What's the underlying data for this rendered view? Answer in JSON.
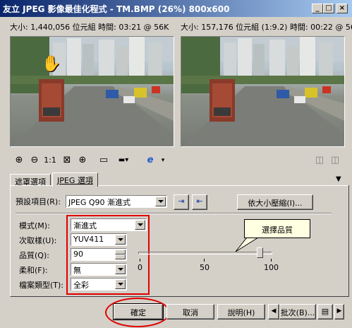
{
  "window": {
    "title": "友立 JPEG 影像最佳化程式 - TM.BMP (26%) 800x600",
    "buttons": {
      "minimize": "_",
      "maximize": "□",
      "close": "×"
    }
  },
  "info": {
    "original": "大小: 1,440,056 位元組 時間: 03:21 @ 56K",
    "optimized": "大小: 157,176 位元組 (1:9.2) 時間: 00:22 @ 56K"
  },
  "toolbar": {
    "zoom_in_icon": "🔍",
    "zoom_out_icon": "🔍",
    "actual_size": "1:1",
    "fit": "⊠",
    "center": "⊕",
    "single_view": "▭",
    "browser": "e",
    "right_icons": [
      "◫",
      "◫"
    ]
  },
  "tabs": [
    {
      "label": "遮罩選項",
      "active": false
    },
    {
      "label": "JPEG 選項",
      "active": true
    }
  ],
  "preset": {
    "label": "預設項目(R):",
    "value": "JPEG Q90 漸進式",
    "compress_button": "依大小壓縮(I)..."
  },
  "fields": {
    "mode": {
      "label": "模式(M):",
      "value": "漸進式"
    },
    "subsampling": {
      "label": "次取樣(U):",
      "value": "YUV411"
    },
    "quality": {
      "label": "品質(Q):",
      "value": "90"
    },
    "smoothing": {
      "label": "柔和(F):",
      "value": "無"
    },
    "file_type": {
      "label": "檔案類型(T):",
      "value": "全彩"
    }
  },
  "slider": {
    "value": 90,
    "min": 0,
    "max": 100,
    "ticks": [
      "0",
      "50",
      "100"
    ]
  },
  "callout": "選擇品質",
  "buttons": {
    "ok": "確定",
    "cancel": "取消",
    "help": "說明(H)",
    "batch": "批次(B)..."
  },
  "colors": {
    "highlight": "#e00000",
    "title_start": "#0a246a",
    "title_end": "#a6caf0"
  }
}
